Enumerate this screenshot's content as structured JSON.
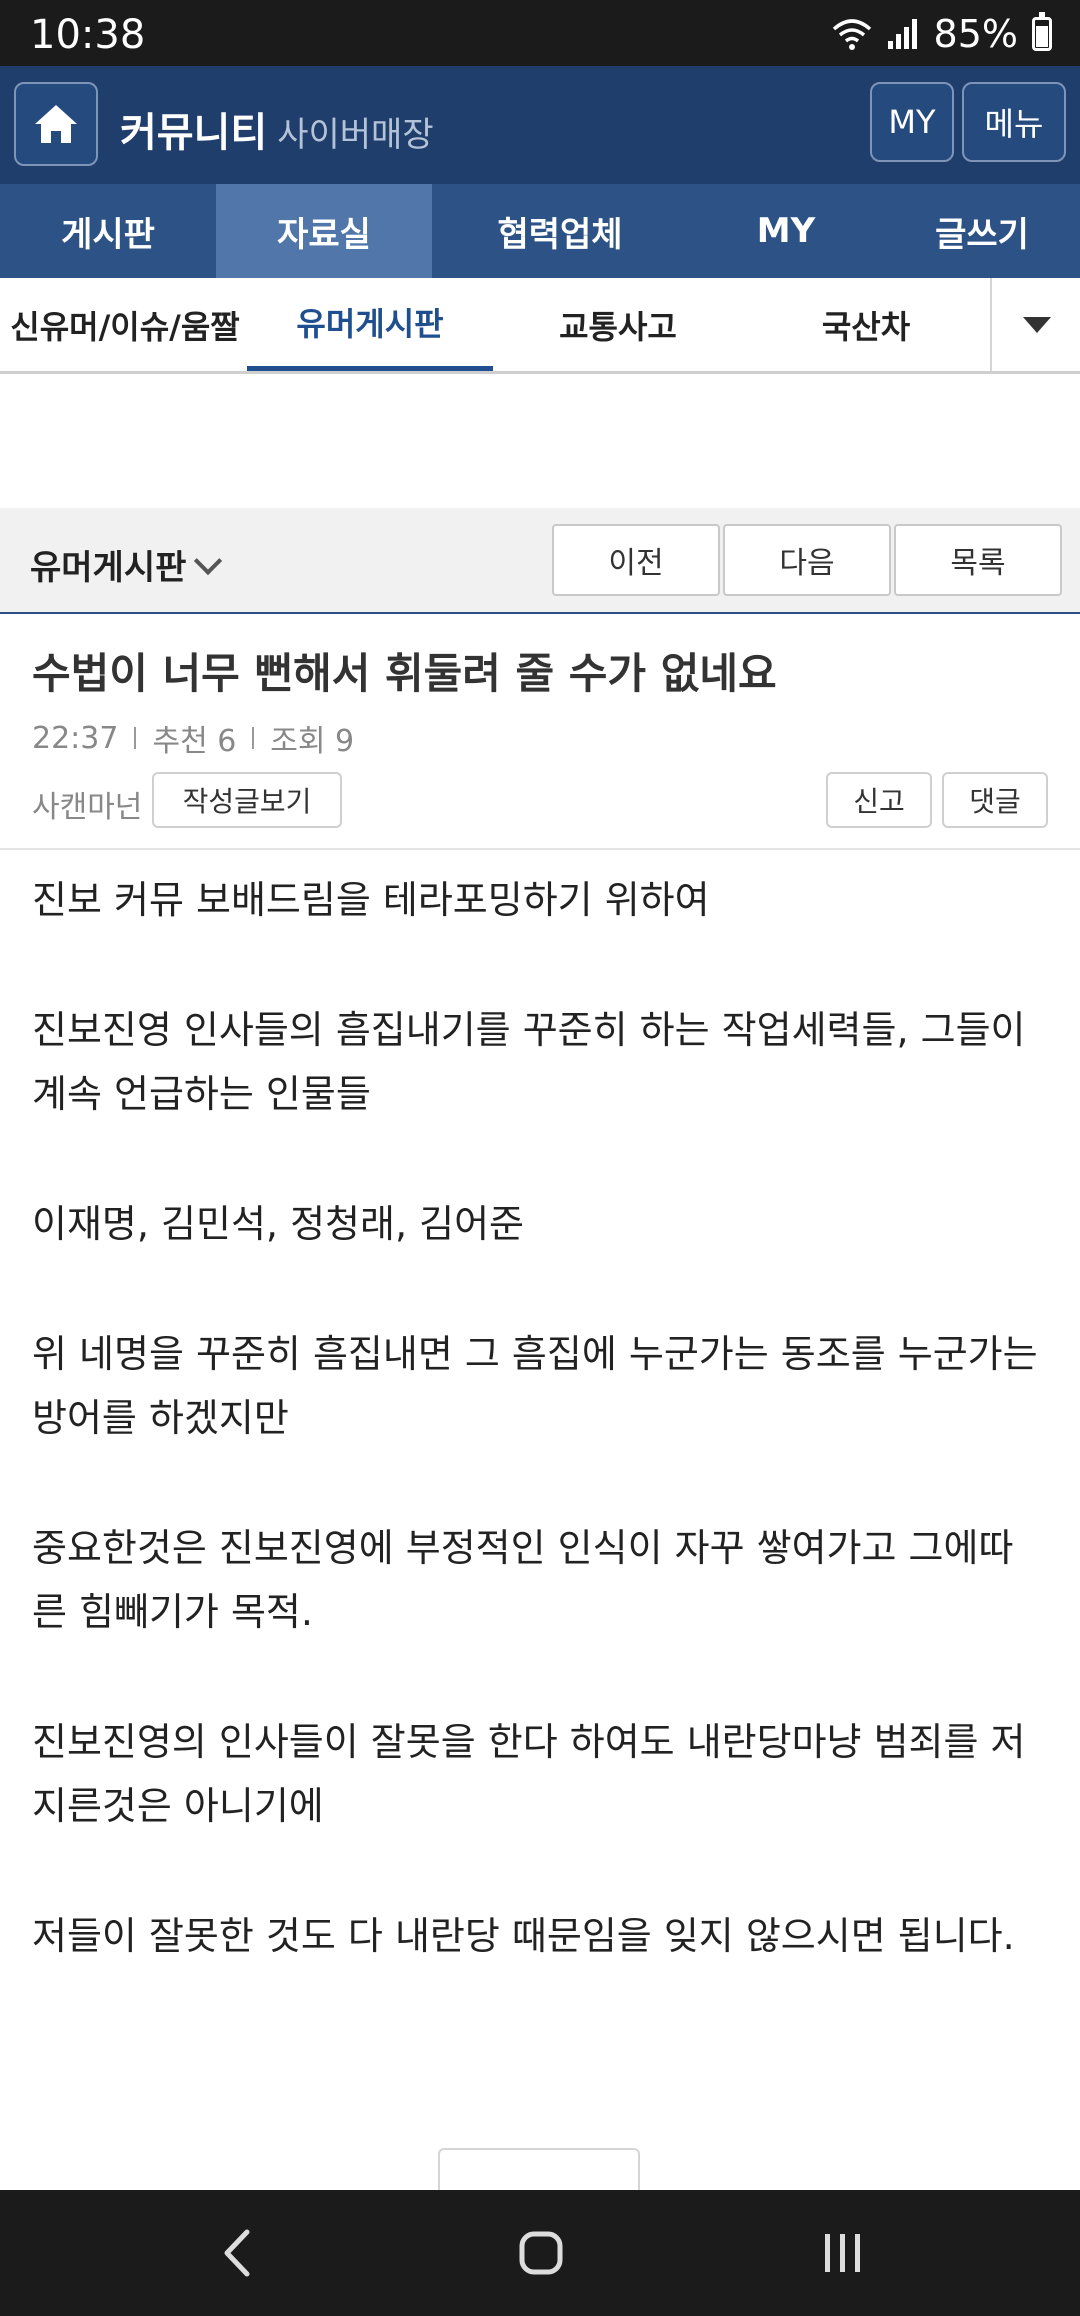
{
  "status_bar": {
    "time": "10:38",
    "battery": "85%"
  },
  "header": {
    "brand": "커뮤니티",
    "brand_sub": "사이버매장",
    "my_label": "MY",
    "menu_label": "메뉴"
  },
  "main_nav": [
    {
      "label": "게시판"
    },
    {
      "label": "자료실",
      "active": true
    },
    {
      "label": "협력업체"
    },
    {
      "label": "MY"
    },
    {
      "label": "글쓰기"
    }
  ],
  "sub_tabs": [
    {
      "label": "신유머/이슈/움짤"
    },
    {
      "label": "유머게시판",
      "active": true
    },
    {
      "label": "교통사고"
    },
    {
      "label": "국산차"
    }
  ],
  "board_bar": {
    "title": "유머게시판",
    "prev": "이전",
    "next": "다음",
    "list": "목록"
  },
  "post": {
    "title": "수법이 너무 뻔해서 휘둘려 줄 수가 없네요",
    "time": "22:37",
    "recommend": "추천 6",
    "views": "조회 9",
    "author": "사캔마넌",
    "view_posts_label": "작성글보기",
    "report_label": "신고",
    "comment_label": "댓글",
    "paragraphs": [
      "진보 커뮤 보배드림을 테라포밍하기 위하여",
      "진보진영 인사들의 흠집내기를 꾸준히 하는 작업세력들, 그들이 계속 언급하는 인물들",
      "이재명, 김민석, 정청래, 김어준",
      "위 네명을 꾸준히 흠집내면 그 흠집에 누군가는 동조를 누군가는 방어를 하겠지만",
      "중요한것은 진보진영에 부정적인 인식이 자꾸 쌓여가고 그에따른 힘빼기가 목적.",
      "진보진영의 인사들이 잘못을 한다 하여도 내란당마냥 범죄를 저지른것은 아니기에",
      "저들이 잘못한 것도 다 내란당 때문임을 잊지 않으시면 됩니다."
    ]
  },
  "colors": {
    "header_bg": "#1f3e6b",
    "nav_bg": "#2d5286",
    "nav_active": "#5076aa",
    "tab_active": "#1f4f8f"
  }
}
